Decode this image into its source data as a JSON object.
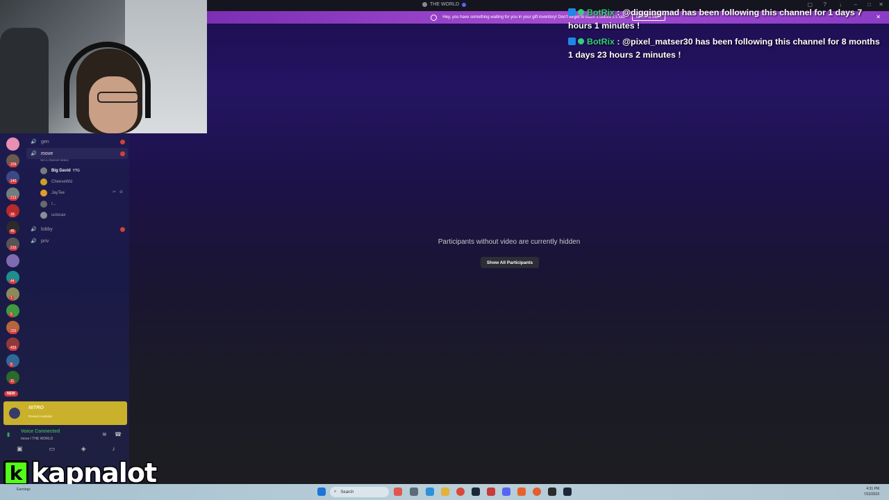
{
  "window": {
    "title": "THE WORLD"
  },
  "banner": {
    "message": "Hey, you have something waiting for you in your gift inventory! Don't forget to claim it before it's lost.",
    "button": "Take me there"
  },
  "chat": [
    {
      "user": "BotRix",
      "text": ": @diggingmad has been following this channel for 1 days 7 hours 1 minutes !"
    },
    {
      "user": "BotRix",
      "text": ": @pixel_matser30 has been following this channel for 8 months 1 days 23 hours 2 minutes !"
    }
  ],
  "stage": {
    "hidden_message": "Participants without video are currently hidden",
    "show_button": "Show All Participants"
  },
  "servers": [
    {
      "color": "#e88fb3",
      "count": ""
    },
    {
      "color": "#6a5a4e",
      "count": "159"
    },
    {
      "color": "#3b4a86",
      "count": "140"
    },
    {
      "color": "#6f7f80",
      "count": "213"
    },
    {
      "color": "#b52a2a",
      "count": "18"
    },
    {
      "color": "#2b2b2b",
      "count": "46"
    },
    {
      "color": "#555555",
      "count": "210"
    },
    {
      "color": "#7e6bb0",
      "count": ""
    },
    {
      "color": "#1e8e8e",
      "count": "44"
    },
    {
      "color": "#8a8a5a",
      "count": "1"
    },
    {
      "color": "#3f9a3f",
      "count": "5"
    },
    {
      "color": "#b5663a",
      "count": "220"
    },
    {
      "color": "#8f3a3a",
      "count": "433"
    },
    {
      "color": "#2f6a9a",
      "count": "5"
    },
    {
      "color": "#2a6a2a",
      "count": "11"
    }
  ],
  "new_label": "NEW",
  "channels": {
    "gen": "gen",
    "move": "move",
    "move_status": "Set a channel status",
    "lobby": "lobby",
    "priv": "priv"
  },
  "members": [
    {
      "name": "Big David",
      "tag": "YTG",
      "color": "#7a7a7a"
    },
    {
      "name": "CheeseWiz",
      "tag": "",
      "color": "#c9a227"
    },
    {
      "name": "JayTee",
      "tag": "",
      "color": "#e39b2a"
    },
    {
      "name": "r...",
      "tag": "",
      "color": "#6a6a6a"
    },
    {
      "name": "uclocax",
      "tag": "",
      "color": "#8a8f96"
    }
  ],
  "promo": {
    "title": "NITRO",
    "subtitle": "Reward Available"
  },
  "voice": {
    "status": "Voice Connected",
    "location": "move / THE WORLD"
  },
  "streamer": {
    "letter": "k",
    "name": "kapnalot"
  },
  "taskbar": {
    "search": "Search",
    "left": "Earnings",
    "time": "4:31 PM",
    "date": "7/22/2023"
  }
}
